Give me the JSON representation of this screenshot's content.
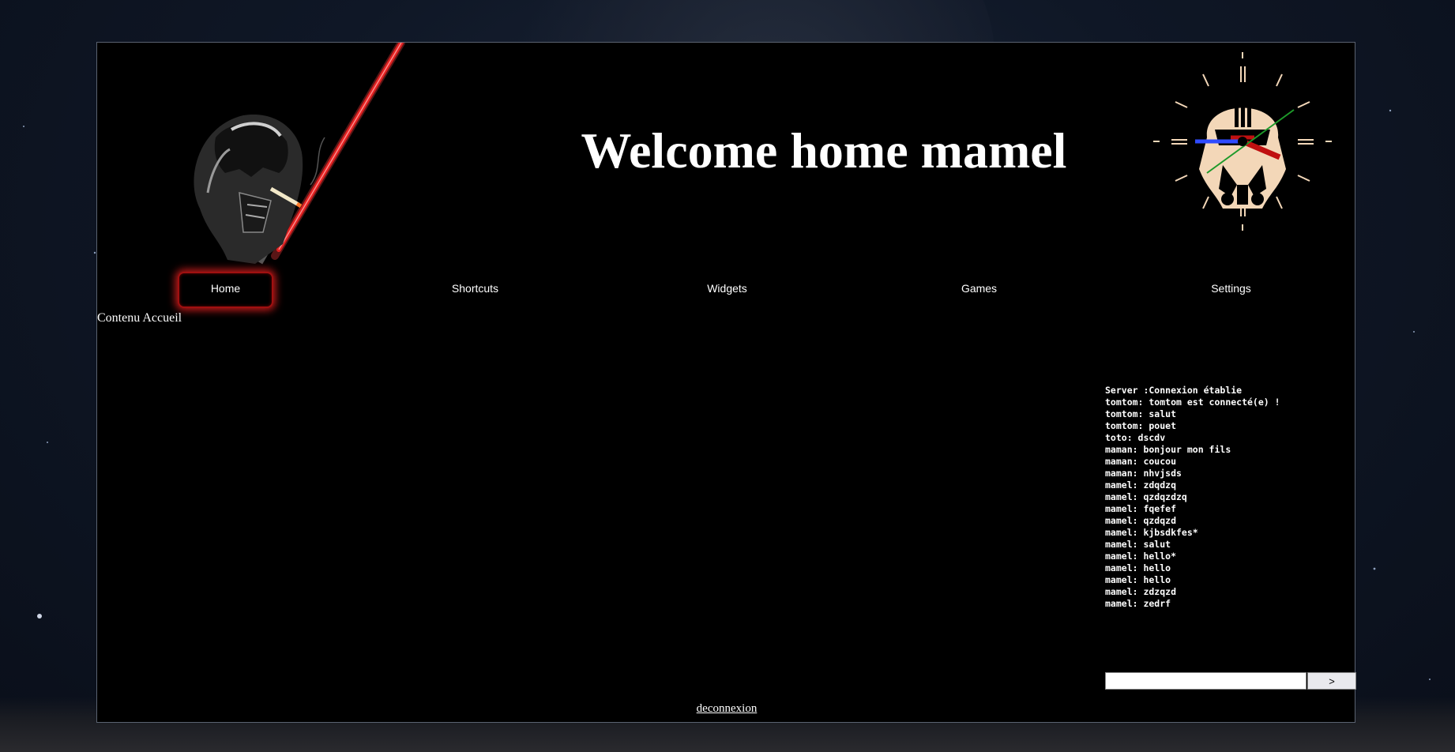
{
  "header": {
    "title": "Welcome home mamel"
  },
  "nav": {
    "items": [
      {
        "label": "Home",
        "active": true
      },
      {
        "label": "Shortcuts",
        "active": false
      },
      {
        "label": "Widgets",
        "active": false
      },
      {
        "label": "Games",
        "active": false
      },
      {
        "label": "Settings",
        "active": false
      }
    ]
  },
  "main": {
    "content_label": "Contenu Accueil"
  },
  "chat": {
    "messages": [
      "Server :Connexion établie",
      "tomtom: tomtom est connecté(e) !",
      "tomtom: salut",
      "tomtom: pouet",
      "toto: dscdv",
      "maman: bonjour mon fils",
      "maman: coucou",
      "maman: nhvjsds",
      "mamel: zdqdzq",
      "mamel: qzdqzdzq",
      "mamel: fqefef",
      "mamel: qzdqzd",
      "mamel: kjbsdkfes*",
      "mamel: salut",
      "mamel: hello*",
      "mamel: hello",
      "mamel: hello",
      "mamel: zdzqzd",
      "mamel: zedrf"
    ],
    "input_value": "",
    "send_label": ">"
  },
  "footer": {
    "logout_label": "deconnexion"
  },
  "colors": {
    "page_bg": "#0f1726",
    "panel_bg": "#000000",
    "active_glow": "#c01a1a",
    "lightsaber": "#e02020",
    "clock_face": "#f3d7b8"
  },
  "icons": {
    "header_left": "vader-smoking-lightsaber",
    "header_right": "stormtrooper-clock"
  }
}
